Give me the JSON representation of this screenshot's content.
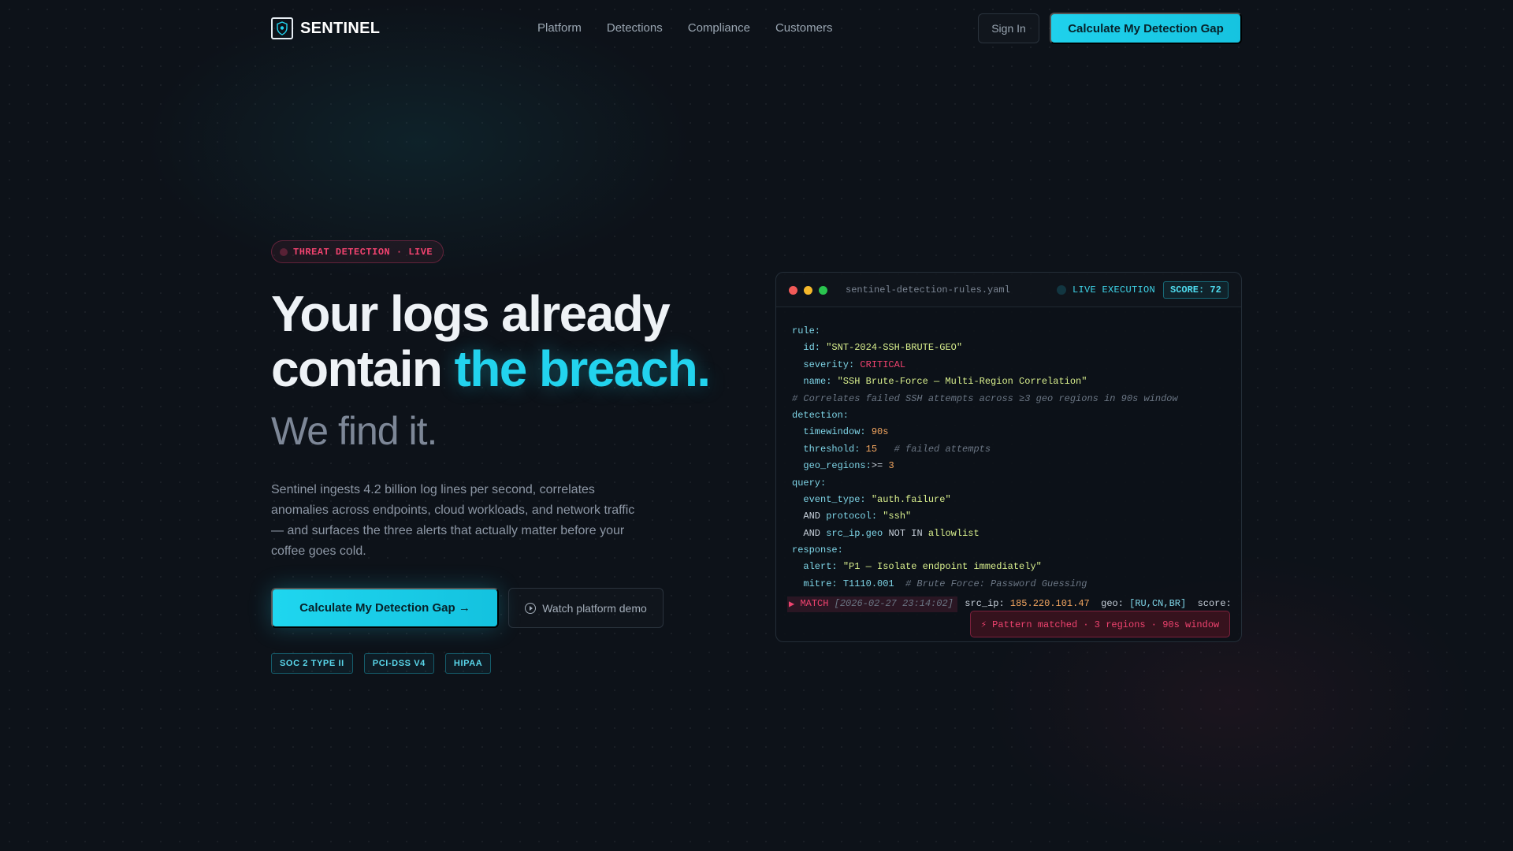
{
  "nav": {
    "brand": "SENTINEL",
    "links": [
      "Platform",
      "Detections",
      "Compliance",
      "Customers"
    ],
    "signin_label": "Sign In",
    "cta_label": "Calculate My Detection Gap"
  },
  "hero": {
    "badge": "THREAT DETECTION · LIVE",
    "headline_part1": "Your logs already contain ",
    "headline_accent": "the breach.",
    "subhead": "We find it.",
    "description": "Sentinel ingests 4.2 billion log lines per second, correlates anomalies across endpoints, cloud workloads, and network traffic — and surfaces the three alerts that actually matter before your coffee goes cold.",
    "cta_primary": "Calculate My Detection Gap →",
    "cta_secondary": "Watch platform demo",
    "compliance": [
      "SOC 2 TYPE II",
      "PCI-DSS V4",
      "HIPAA"
    ]
  },
  "panel": {
    "filename": "sentinel-detection-rules.yaml",
    "live_label": "LIVE EXECUTION",
    "score_label": "SCORE: 72",
    "code": {
      "rule": "rule:",
      "id_key": "  id: ",
      "id_val": "\"SNT-2024-SSH-BRUTE-GEO\"",
      "severity_key": "  severity: ",
      "severity_val": "CRITICAL",
      "name_key": "  name: ",
      "name_val": "\"SSH Brute-Force — Multi-Region Correlation\"",
      "comment1": "# Correlates failed SSH attempts across ≥3 geo regions in 90s window",
      "detection": "detection:",
      "tw_key": "  timewindow: ",
      "tw_val": "90s",
      "th_key": "  threshold: ",
      "th_val": "15",
      "th_comment": "   # failed attempts",
      "geo_key": "  geo_regions:",
      "geo_op": ">= ",
      "geo_val": "3",
      "query": "query:",
      "et_key": "  event_type: ",
      "et_val": "\"auth.failure\"",
      "and1": "  AND ",
      "proto_key": "protocol: ",
      "proto_val": "\"ssh\"",
      "and2": "  AND ",
      "srcgeo_key": "src_ip.geo ",
      "notin": "NOT IN ",
      "allow_val": "allowlist",
      "response": "response:",
      "alert_key": "  alert: ",
      "alert_val": "\"P1 — Isolate endpoint immediately\"",
      "mitre_key": "  mitre: ",
      "mitre_val": "T1110.001",
      "mitre_comment": "  # Brute Force: Password Guessing"
    },
    "match": {
      "arrow": "▶ ",
      "label": "MATCH ",
      "timestamp": "[2026-02-27 23:14:02]",
      "srcip_key": "  src_ip: ",
      "srcip_val": "185.220.101.47",
      "geo_key": "  geo: ",
      "geo_val": "[RU,CN,BR]",
      "score_key": "  score:"
    },
    "toast": "⚡ Pattern matched · 3 regions · 90s window"
  }
}
